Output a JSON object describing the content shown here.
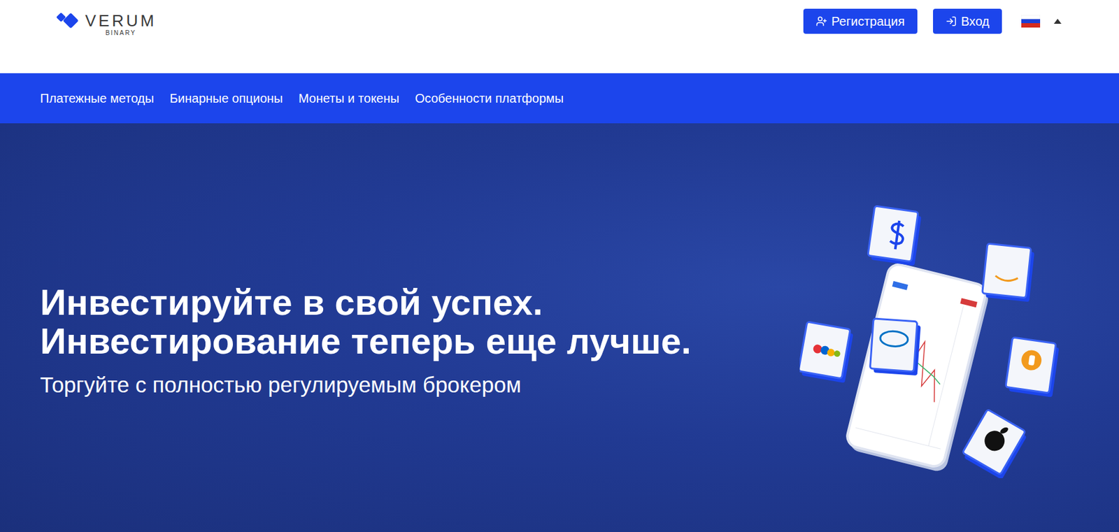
{
  "logo": {
    "name": "VERUM",
    "tagline": "BINARY"
  },
  "header_buttons": [
    {
      "label": "Регистрация",
      "kind": "register"
    },
    {
      "label": "Вход",
      "kind": "login"
    }
  ],
  "nav": [
    "Платежные методы",
    "Бинарные опционы",
    "Монеты и токены",
    "Особенности платформы"
  ],
  "hero": {
    "title_lines": [
      "Инвестируйте в свой успех.",
      "Инвестирование теперь еще лучше."
    ],
    "subtitle": "Торгуйте с полностью регулируемым брокером"
  }
}
